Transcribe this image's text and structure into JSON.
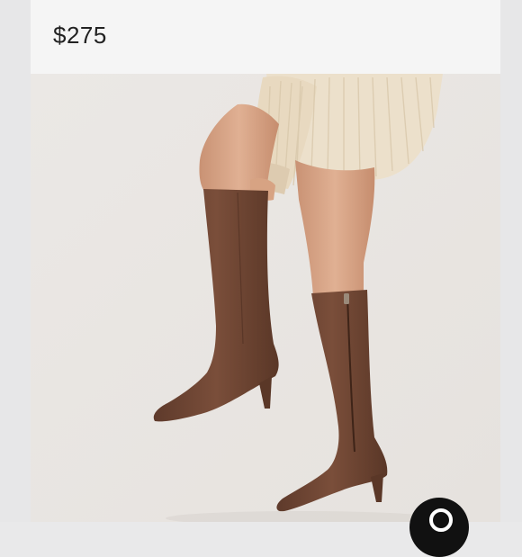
{
  "listing": {
    "price": "$275"
  },
  "photo": {
    "subject": "suede-knee-high-boots",
    "colors": {
      "background": "#eae7e4",
      "sweater": "#ece0cb",
      "skin": "#d9a788",
      "boot": "#6e4533"
    }
  },
  "action_button": {
    "icon": "search-icon",
    "color": "#111111"
  }
}
